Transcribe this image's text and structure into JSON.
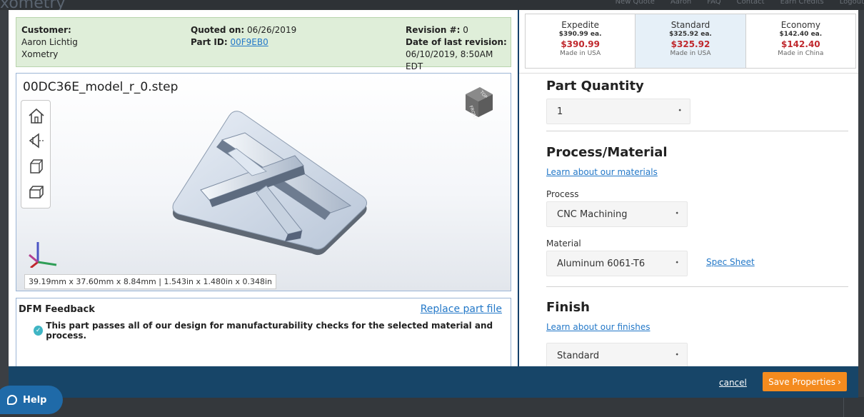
{
  "background_nav": {
    "logo": "xometry",
    "links": [
      "New Quote",
      "Aaron",
      "FAQ",
      "Contact",
      "Earn Credits",
      "Logout"
    ]
  },
  "info": {
    "customer_label": "Customer:",
    "customer_name": "Aaron Lichtig",
    "customer_company": "Xometry",
    "quoted_label": "Quoted on:",
    "quoted_date": "06/26/2019",
    "partid_label": "Part ID:",
    "partid_value": "00F9EB0",
    "revision_label": "Revision #:",
    "revision_value": "0",
    "last_revision_label": "Date of last revision:",
    "last_revision_value": "06/10/2019, 8:50AM EDT"
  },
  "viewer": {
    "filename": "00DC36E_model_r_0.step",
    "dimensions": "39.19mm x 37.60mm x 8.84mm | 1.543in x 1.480in x 0.348in",
    "cube_labels": {
      "front": "FRONT",
      "top": "TOP"
    }
  },
  "dfm": {
    "title": "DFM Feedback",
    "replace_link": "Replace part file",
    "message": "This part passes all of our design for manufacturability checks for the selected material and process."
  },
  "tiers": [
    {
      "name": "Expedite",
      "each": "$390.99 ea.",
      "total": "$390.99",
      "origin": "Made in USA"
    },
    {
      "name": "Standard",
      "each": "$325.92 ea.",
      "total": "$325.92",
      "origin": "Made in USA"
    },
    {
      "name": "Economy",
      "each": "$142.40 ea.",
      "total": "$142.40",
      "origin": "Made in China"
    }
  ],
  "form": {
    "quantity_title": "Part Quantity",
    "quantity_value": "1",
    "process_title": "Process/Material",
    "materials_link": "Learn about our materials",
    "process_label": "Process",
    "process_value": "CNC Machining",
    "material_label": "Material",
    "material_value": "Aluminum 6061-T6",
    "spec_sheet": "Spec Sheet",
    "finish_title": "Finish",
    "finishes_link": "Learn about our finishes",
    "finish_value": "Standard"
  },
  "footer": {
    "cancel": "cancel",
    "save": "Save Properties",
    "save_chevron": "›"
  },
  "help": {
    "label": "Help"
  },
  "colors": {
    "accent_orange": "#f48b1e",
    "navy": "#174568",
    "price_red": "#c0282d",
    "link_blue": "#2378c8",
    "info_green": "#dfeed9"
  }
}
